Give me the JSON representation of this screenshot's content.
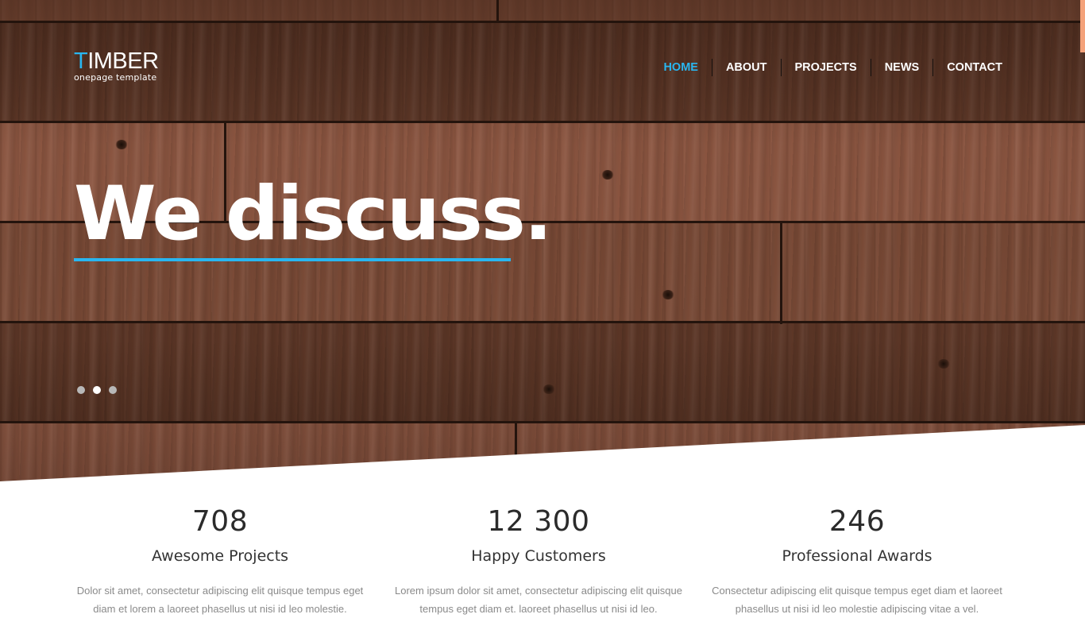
{
  "brand": {
    "logo_initial": "T",
    "logo_rest": "IMBER",
    "tagline": "onepage template",
    "accent_color": "#29b6f0"
  },
  "nav": {
    "items": [
      {
        "label": "HOME",
        "active": true
      },
      {
        "label": "ABOUT",
        "active": false
      },
      {
        "label": "PROJECTS",
        "active": false
      },
      {
        "label": "NEWS",
        "active": false
      },
      {
        "label": "CONTACT",
        "active": false
      }
    ]
  },
  "hero": {
    "headline": "We discuss.",
    "slider": {
      "slide_count": 3,
      "active_index": 1
    }
  },
  "stats": [
    {
      "value": "708",
      "label": "Awesome Projects",
      "text_line1": "Dolor sit amet, consectetur adipiscing elit quisque tempus eget",
      "text_line2": "diam et lorem a laoreet phasellus ut nisi id leo molestie."
    },
    {
      "value": "12 300",
      "label": "Happy Customers",
      "text_line1": "Lorem ipsum dolor sit amet, consectetur adipiscing elit quisque",
      "text_line2": "tempus eget diam et. laoreet phasellus ut nisi id leo."
    },
    {
      "value": "246",
      "label": "Professional Awards",
      "text_line1": "Consectetur adipiscing elit quisque tempus eget diam et laoreet",
      "text_line2": "phasellus ut nisi id leo molestie adipiscing vitae a vel."
    }
  ]
}
